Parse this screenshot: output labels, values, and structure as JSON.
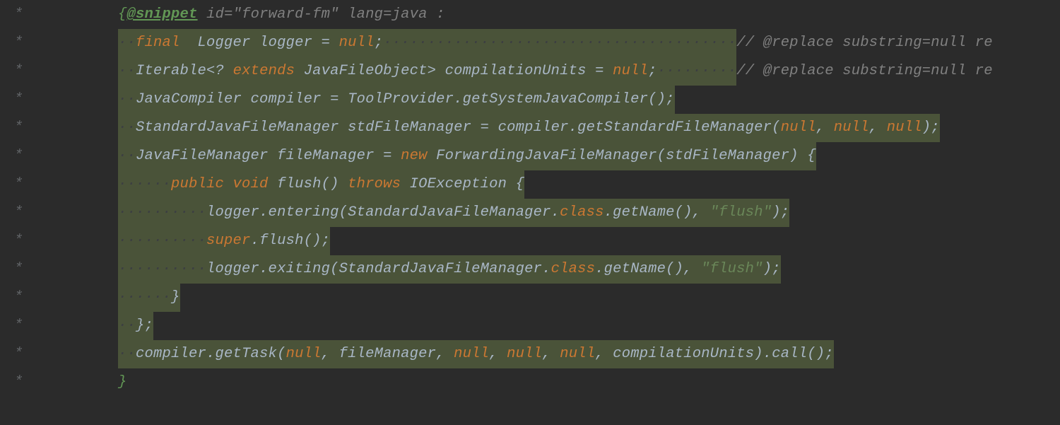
{
  "stars": [
    "*",
    "*",
    "*",
    "*",
    "*",
    "*",
    "*",
    "*",
    "*",
    "*",
    "*",
    "*",
    "*",
    "*",
    "*"
  ],
  "snippet_open_brace": "{",
  "snippet_tag": "@snippet",
  "snippet_attrs": " id=\"forward-fm\" lang=java :",
  "lines": {
    "l1_final": "final ",
    "l1_logger_decl": " Logger logger = ",
    "l1_null": "null",
    "l1_semi": ";",
    "l1_comment": "// @replace substring=null re",
    "l2_iterable": "Iterable<? ",
    "l2_extends": "extends",
    "l2_rest": " JavaFileObject> compilationUnits = ",
    "l2_null": "null",
    "l2_semi": ";",
    "l2_comment": "// @replace substring=null re",
    "l3": "JavaCompiler compiler = ToolProvider.getSystemJavaCompiler();",
    "l4_a": "StandardJavaFileManager stdFileManager = compiler.getStandardFileManager(",
    "l4_null": "null",
    "l4_c": ", ",
    "l4_end": ");",
    "l5_a": "JavaFileManager fileManager = ",
    "l5_new": "new",
    "l5_b": " ForwardingJavaFileManager(stdFileManager) {",
    "l6_public": "public ",
    "l6_void": "void",
    "l6_sig": " flush() ",
    "l6_throws": "throws",
    "l6_rest": " IOException {",
    "l7_a": "logger.entering(StandardJavaFileManager.",
    "l7_class": "class",
    "l7_b": ".getName(), ",
    "l7_str": "\"flush\"",
    "l7_end": ");",
    "l8_super": "super",
    "l8_rest": ".flush();",
    "l9_a": "logger.exiting(StandardJavaFileManager.",
    "l9_class": "class",
    "l9_b": ".getName(), ",
    "l9_str": "\"flush\"",
    "l9_end": ");",
    "l10": "}",
    "l11": "};",
    "l12_a": "compiler.getTask(",
    "l12_null": "null",
    "l12_c": ", fileManager, ",
    "l12_c2": ", ",
    "l12_rest": ", compilationUnits).call();",
    "l13": "}"
  },
  "dots5": "·····"
}
